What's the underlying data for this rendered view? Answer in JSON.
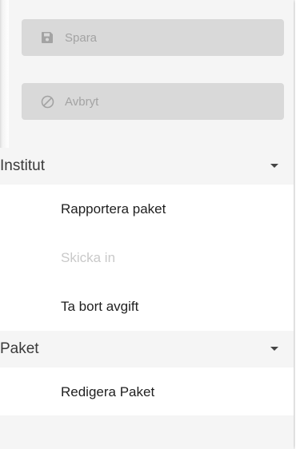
{
  "actions": {
    "save_label": "Spara",
    "cancel_label": "Avbryt"
  },
  "sections": [
    {
      "title": "Institut",
      "items": [
        {
          "label": "Rapportera paket",
          "enabled": true
        },
        {
          "label": "Skicka in",
          "enabled": false
        },
        {
          "label": "Ta bort avgift",
          "enabled": true
        }
      ]
    },
    {
      "title": "Paket",
      "items": [
        {
          "label": "Redigera Paket",
          "enabled": true
        }
      ]
    }
  ],
  "colors": {
    "button_bg": "#d9d9d9",
    "button_text": "#a3a3a3",
    "disabled_text": "#c9c9c9",
    "panel_bg": "#f5f5f5"
  },
  "icons": {
    "save": "floppy-disk-icon",
    "cancel": "block-icon",
    "section_toggle": "caret-down-icon"
  }
}
